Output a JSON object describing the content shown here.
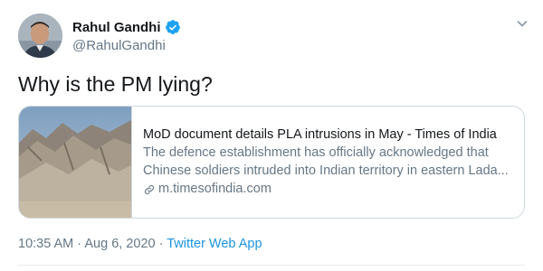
{
  "user": {
    "name": "Rahul Gandhi",
    "handle": "@RahulGandhi",
    "verified": true
  },
  "tweet": {
    "text": "Why is the PM lying?"
  },
  "card": {
    "title": "MoD document details PLA intrusions in May - Times of India",
    "description_line1": "The defence establishment has officially acknowledged that",
    "description_line2": "Chinese soldiers intruded into Indian territory in eastern Lada...",
    "domain": "m.timesofindia.com",
    "link_icon": "link-icon"
  },
  "meta": {
    "time": "10:35 AM",
    "separator1": " · ",
    "date": "Aug 6, 2020",
    "separator2": " · ",
    "source": "Twitter Web App"
  },
  "colors": {
    "text_primary": "#14171a",
    "text_secondary": "#657786",
    "link_blue": "#1b95e0",
    "verified_blue": "#1da1f2",
    "border": "#cfd9de"
  },
  "icons": {
    "verified": "verified-badge-icon",
    "menu": "chevron-down-icon"
  }
}
